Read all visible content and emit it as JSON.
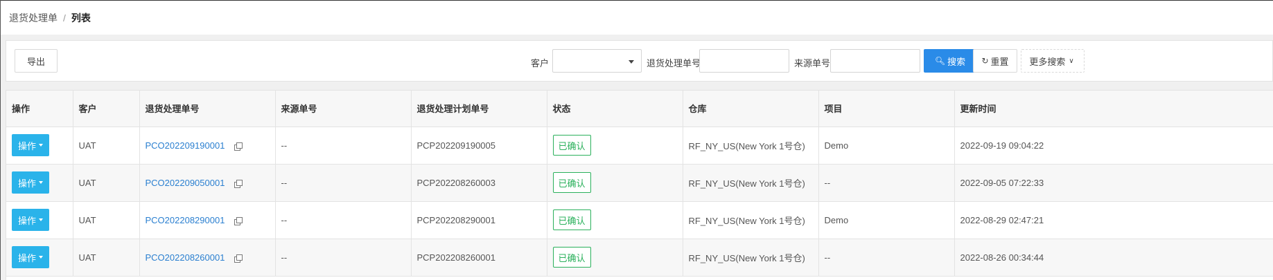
{
  "breadcrumb": {
    "root": "退货处理单",
    "separator": "/",
    "current": "列表"
  },
  "toolbar": {
    "export_label": "导出",
    "customer_label": "客户",
    "customer_value": "",
    "return_no_label": "退货处理单号",
    "return_no_value": "",
    "source_no_label": "来源单号",
    "source_no_value": "",
    "search_label": "搜索",
    "reset_label": "重置",
    "more_search_label": "更多搜索"
  },
  "colors": {
    "primary": "#2a8be8",
    "op_button": "#2ab3ea",
    "link": "#2a7fd0",
    "status_green": "#2ab05b"
  },
  "icons": {
    "search": "search-icon",
    "reset": "refresh-icon",
    "more": "chevron-down-icon",
    "copy": "copy-icon",
    "dropdown": "caret-down-icon"
  },
  "table": {
    "columns": [
      "操作",
      "客户",
      "退货处理单号",
      "来源单号",
      "退货处理计划单号",
      "状态",
      "仓库",
      "项目",
      "更新时间"
    ],
    "rows": [
      {
        "op": "操作",
        "customer": "UAT",
        "return_no": "PCO202209190001",
        "source_no": "--",
        "plan_no": "PCP202209190005",
        "status": "已确认",
        "warehouse": "RF_NY_US(New York 1号仓)",
        "project": "Demo",
        "updated": "2022-09-19 09:04:22"
      },
      {
        "op": "操作",
        "customer": "UAT",
        "return_no": "PCO202209050001",
        "source_no": "--",
        "plan_no": "PCP202208260003",
        "status": "已确认",
        "warehouse": "RF_NY_US(New York 1号仓)",
        "project": "--",
        "updated": "2022-09-05 07:22:33"
      },
      {
        "op": "操作",
        "customer": "UAT",
        "return_no": "PCO202208290001",
        "source_no": "--",
        "plan_no": "PCP202208290001",
        "status": "已确认",
        "warehouse": "RF_NY_US(New York 1号仓)",
        "project": "Demo",
        "updated": "2022-08-29 02:47:21"
      },
      {
        "op": "操作",
        "customer": "UAT",
        "return_no": "PCO202208260001",
        "source_no": "--",
        "plan_no": "PCP202208260001",
        "status": "已确认",
        "warehouse": "RF_NY_US(New York 1号仓)",
        "project": "--",
        "updated": "2022-08-26 00:34:44"
      }
    ]
  }
}
